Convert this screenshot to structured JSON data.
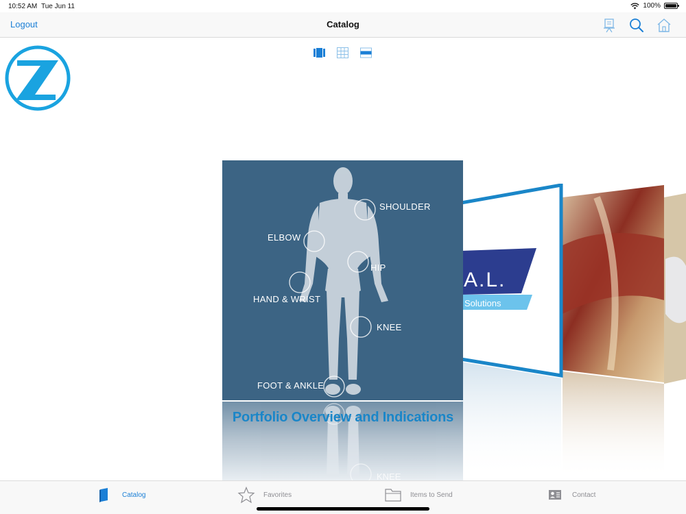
{
  "status_bar": {
    "time": "10:52 AM",
    "date": "Tue Jun 11",
    "battery": "100%"
  },
  "nav": {
    "logout_label": "Logout",
    "title": "Catalog"
  },
  "icons": {
    "easel": "easel-icon",
    "search": "search-icon",
    "home": "home-icon",
    "logo": "zimmer-logo"
  },
  "colors": {
    "accent": "#1a7fd6",
    "logo_blue": "#1aa3e0",
    "cover_bg": "#3c6484",
    "title_blue": "#1a86c8"
  },
  "view_modes": [
    "coverflow",
    "grid",
    "list"
  ],
  "main_cover": {
    "labels": {
      "shoulder": "SHOULDER",
      "elbow": "ELBOW",
      "hip": "HIP",
      "hand_wrist": "HAND & WRIST",
      "knee": "KNEE",
      "foot_ankle": "FOOT & ANKLE"
    },
    "title": "Portfolio Overview and Indications",
    "reflection_label": "KNEE"
  },
  "side_cover_1": {
    "text_large": "A.L.",
    "text_small": "Solutions"
  },
  "tabs": [
    {
      "label": "Catalog",
      "icon": "book-icon",
      "active": true
    },
    {
      "label": "Favorites",
      "icon": "star-icon",
      "active": false
    },
    {
      "label": "Items to Send",
      "icon": "folder-icon",
      "active": false
    },
    {
      "label": "Contact",
      "icon": "contact-card-icon",
      "active": false
    }
  ]
}
